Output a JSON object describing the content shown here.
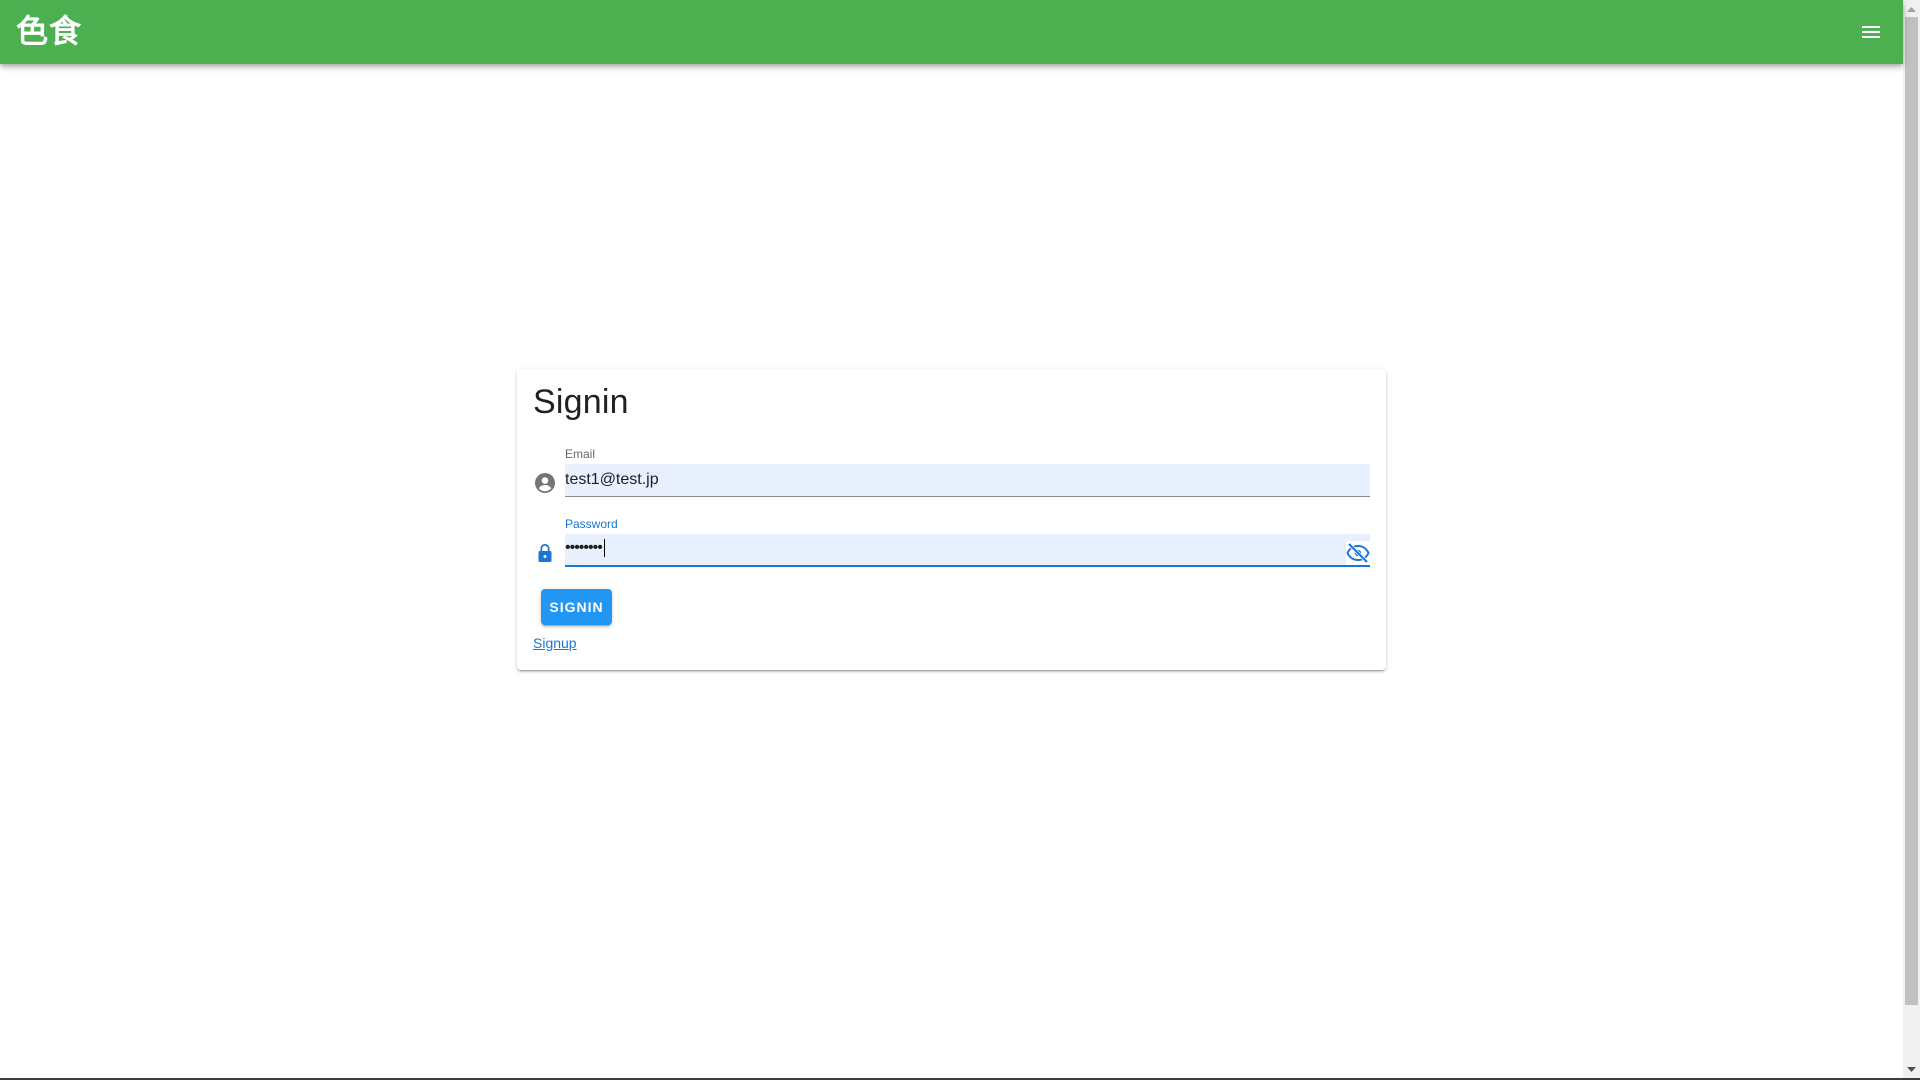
{
  "app": {
    "title": "色食",
    "brand_color": "#4caf50",
    "menu_icon": "hamburger-menu-icon"
  },
  "signin_form": {
    "title": "Signin",
    "email": {
      "label": "Email",
      "value": "test1@test.jp",
      "icon": "account-circle-icon"
    },
    "password": {
      "label": "Password",
      "masked_value": "••••••••",
      "icon": "lock-icon",
      "toggle_icon": "eye-off-icon"
    },
    "submit_label": "SIGNIN",
    "signup_link": "Signup",
    "primary_color": "#2196f3",
    "focus_color": "#1976d2"
  }
}
